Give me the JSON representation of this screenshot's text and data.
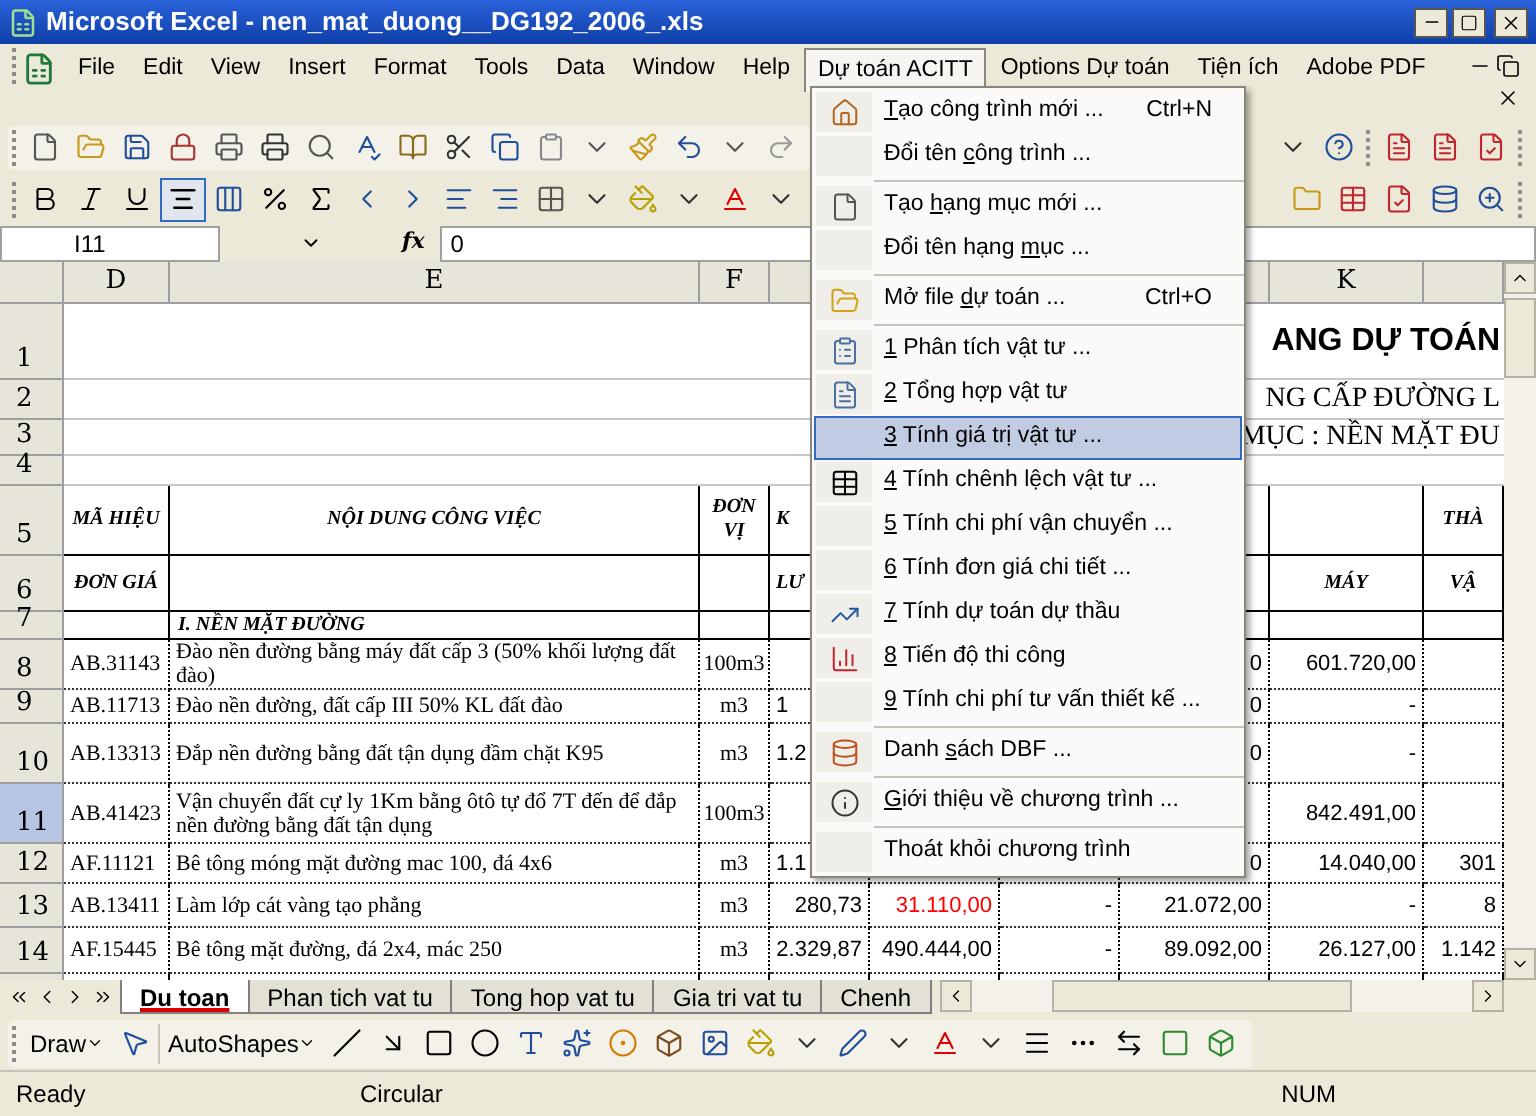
{
  "window": {
    "title": "Microsoft Excel - nen_mat_duong__DG192_2006_.xls"
  },
  "menubar": {
    "items": [
      {
        "label": "File",
        "selected": false
      },
      {
        "label": "Edit",
        "selected": false
      },
      {
        "label": "View",
        "selected": false
      },
      {
        "label": "Insert",
        "selected": false
      },
      {
        "label": "Format",
        "selected": false
      },
      {
        "label": "Tools",
        "selected": false
      },
      {
        "label": "Data",
        "selected": false
      },
      {
        "label": "Window",
        "selected": false
      },
      {
        "label": "Help",
        "selected": false
      },
      {
        "label": "Dự toán ACITT",
        "selected": true
      },
      {
        "label": "Options Dự toán",
        "selected": false
      },
      {
        "label": "Tiện ích",
        "selected": false
      },
      {
        "label": "Adobe PDF",
        "selected": false
      }
    ]
  },
  "formula_bar": {
    "name_box": "I11",
    "fx_label": "fx",
    "value": "0"
  },
  "column_headers": [
    "D",
    "E",
    "F",
    "K"
  ],
  "rows": [
    {
      "header": "1",
      "selected": false,
      "kind": "banner",
      "title": "ANG DỰ TOÁN"
    },
    {
      "header": "2",
      "selected": false,
      "kind": "subtitle",
      "title": "NG CẤP ĐƯỜNG L"
    },
    {
      "header": "3",
      "selected": false,
      "kind": "subtitle",
      "title": "MỤC : NỀN MẶT ĐU"
    },
    {
      "header": "4",
      "selected": false,
      "kind": "blank"
    },
    {
      "header": "5",
      "selected": false,
      "kind": "heading",
      "cells": {
        "D": "MÃ HIỆU",
        "E": "NỘI DUNG CÔNG VIỆC",
        "F": "ĐƠN VỊ",
        "G": "K",
        "L": "THÀ"
      }
    },
    {
      "header": "6",
      "selected": false,
      "kind": "heading",
      "cells": {
        "D": "ĐƠN GIÁ",
        "G": "LƯ",
        "K": "MÁY",
        "L": "VẬ"
      }
    },
    {
      "header": "7",
      "selected": false,
      "kind": "section",
      "cells": {
        "E": "I. NỀN MẶT ĐƯỜNG"
      }
    },
    {
      "header": "8",
      "selected": false,
      "kind": "item",
      "cells": {
        "D": "AB.31143",
        "E": "Đào nền đường  bằng máy đất cấp 3 (50% khối lượng đất đào)",
        "F": "100m3",
        "J": "0",
        "K": "601.720,00"
      }
    },
    {
      "header": "9",
      "selected": false,
      "kind": "item",
      "cells": {
        "D": "AB.11713",
        "E": "Đào nền đường, đất cấp III 50% KL đất đào",
        "F": "m3",
        "G": "1",
        "J": "0",
        "K": "-"
      }
    },
    {
      "header": "10",
      "selected": false,
      "kind": "item",
      "cells": {
        "D": "AB.13313",
        "E": "Đắp nền đường bằng đất tận dụng đầm chặt K95",
        "F": "m3",
        "G": "1.2",
        "J": "0",
        "K": "-"
      }
    },
    {
      "header": "11",
      "selected": true,
      "kind": "item",
      "cells": {
        "D": "AB.41423",
        "E": "Vận chuyển  đất cự ly 1Km bằng ôtô tự đổ 7T đến để đắp nền đường bằng đất tận dụng",
        "F": "100m3",
        "K": "842.491,00"
      }
    },
    {
      "header": "12",
      "selected": false,
      "kind": "item",
      "cells": {
        "D": "AF.11121",
        "E": "Bê tông móng mặt đường mac 100, đá 4x6",
        "F": "m3",
        "G": "1.1",
        "J": "0",
        "K": "14.040,00",
        "L": "301"
      }
    },
    {
      "header": "13",
      "selected": false,
      "kind": "item",
      "cells": {
        "D": "AB.13411",
        "E": "Làm lớp cát vàng tạo phẳng",
        "F": "m3",
        "G": "280,73",
        "H": {
          "text": "31.110,00",
          "color": "#ff0000"
        },
        "I": "-",
        "J": "21.072,00",
        "K": "-",
        "L": "8"
      }
    },
    {
      "header": "14",
      "selected": false,
      "kind": "item",
      "cells": {
        "D": "AF.15445",
        "E": "Bê tông mặt đường, đá 2x4, mác 250",
        "F": "m3",
        "G": "2.329,87",
        "H": "490.444,00",
        "I": "-",
        "J": "89.092,00",
        "K": "26.127,00",
        "L": "1.142"
      }
    }
  ],
  "dropdown": {
    "groups": [
      [
        {
          "key": "T",
          "post": "ạo công trình mới ...",
          "shortcut": "Ctrl+N",
          "selected": false
        },
        {
          "pre": "Đổi tên ",
          "key": "c",
          "post": "ông trình ...",
          "selected": false
        }
      ],
      [
        {
          "pre": "Tạo ",
          "key": "h",
          "post": "ạng mục mới ...",
          "selected": false
        },
        {
          "pre": "Đổi tên hạng ",
          "key": "m",
          "post": "ục ...",
          "selected": false
        }
      ],
      [
        {
          "pre": "Mở file ",
          "key": "d",
          "post": "ự toán ...",
          "shortcut": "Ctrl+O",
          "selected": false
        }
      ],
      [
        {
          "key": "1",
          "post": " Phân tích vật tư ...",
          "selected": false
        },
        {
          "key": "2",
          "post": " Tổng hợp vật tư",
          "selected": false
        },
        {
          "key": "3",
          "post": " Tính giá trị vật tư ...",
          "selected": true
        },
        {
          "key": "4",
          "post": " Tính chênh lệch vật tư ...",
          "selected": false
        },
        {
          "key": "5",
          "post": " Tính chi phí vận chuyển ...",
          "selected": false
        },
        {
          "key": "6",
          "post": " Tính đơn giá chi tiết ...",
          "selected": false
        },
        {
          "key": "7",
          "post": " Tính dự toán dự thầu",
          "selected": false
        },
        {
          "key": "8",
          "post": " Tiến độ thi công",
          "selected": false
        },
        {
          "key": "9",
          "post": " Tính chi phí tư vấn thiết kế ...",
          "selected": false
        }
      ],
      [
        {
          "pre": "Danh ",
          "key": "s",
          "post": "ách DBF ...",
          "selected": false
        }
      ],
      [
        {
          "key": "G",
          "post": "iới thiệu về chương trình ...",
          "selected": false
        }
      ],
      [
        {
          "pre": "Thoát khỏi chương trình",
          "selected": false
        }
      ]
    ]
  },
  "sheet_tabs": [
    {
      "label": "Du toan",
      "selected": true
    },
    {
      "label": "Phan tich vat tu",
      "selected": false
    },
    {
      "label": "Tong hop vat tu",
      "selected": false
    },
    {
      "label": "Gia tri vat tu",
      "selected": false
    },
    {
      "label": "Chenh",
      "selected": false
    }
  ],
  "drawing_toolbar": {
    "draw": "Draw",
    "autoshapes": "AutoShapes"
  },
  "status_bar": {
    "state": "Ready",
    "message": "Circular",
    "num": "NUM"
  }
}
